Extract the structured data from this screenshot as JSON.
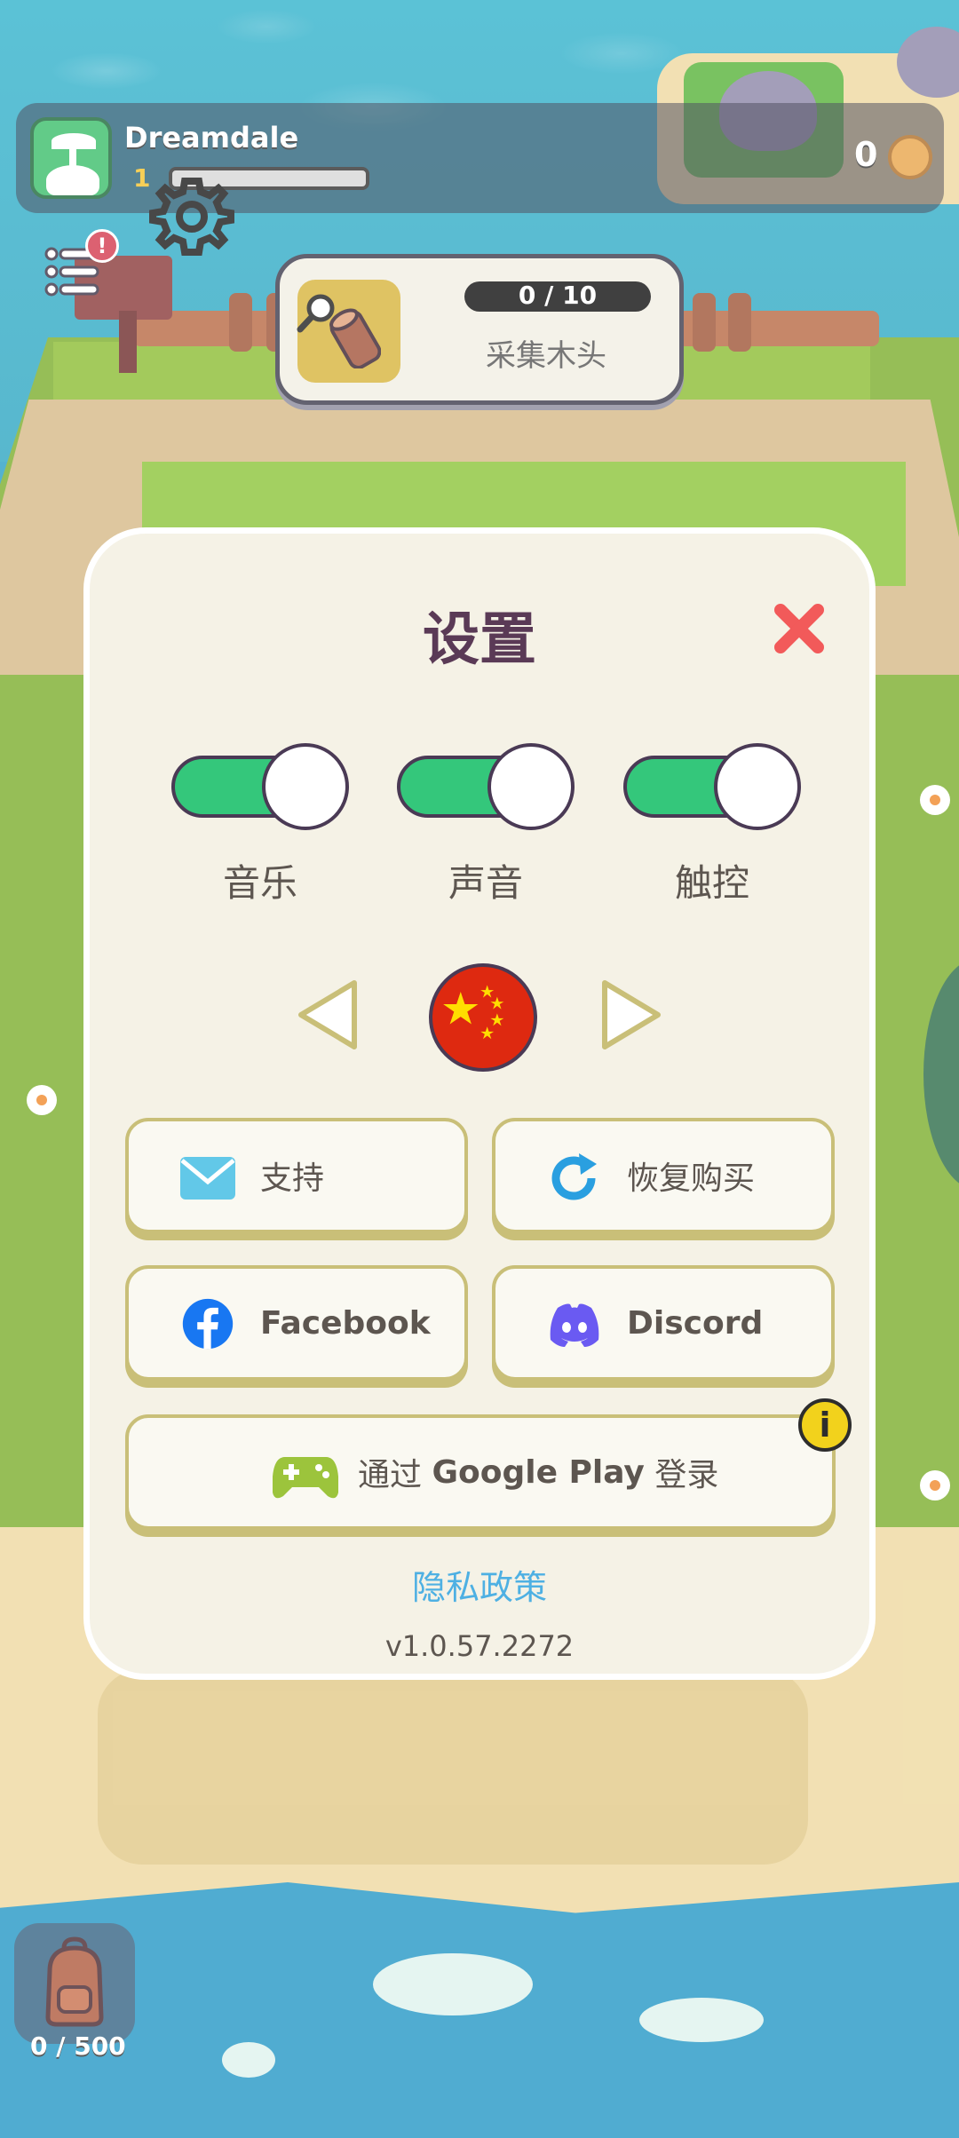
{
  "hud": {
    "player_name": "Dreamdale",
    "level": "1",
    "xp_progress": 0,
    "coins": "0",
    "menu_badge": "!",
    "bag_count": "0 / 500"
  },
  "quest": {
    "progress": "0 / 10",
    "title": "采集木头"
  },
  "settings": {
    "title": "设置",
    "toggles": [
      {
        "label": "音乐",
        "on": true
      },
      {
        "label": "声音",
        "on": true
      },
      {
        "label": "触控",
        "on": true
      }
    ],
    "language_flag": "china-flag-icon",
    "buttons": {
      "support": "支持",
      "restore": "恢复购买",
      "facebook": "Facebook",
      "discord": "Discord",
      "google_prefix": "通过 ",
      "google_brand": "Google Play",
      "google_suffix": " 登录"
    },
    "info_badge": "i",
    "privacy": "隐私政策",
    "version": "v1.0.57.2272"
  },
  "colors": {
    "toggle_on": "#34c77b",
    "close": "#f25a5a",
    "facebook": "#1877f2",
    "discord": "#5865f2",
    "link": "#4eb0e3"
  }
}
